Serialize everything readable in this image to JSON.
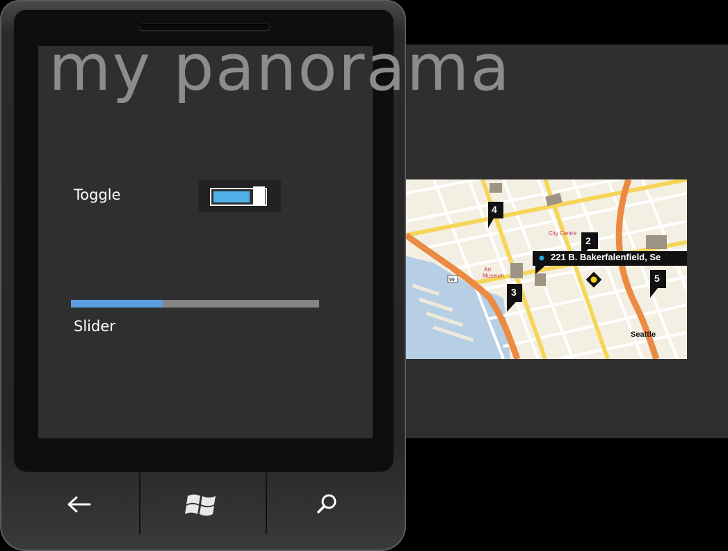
{
  "panorama": {
    "title": "my panorama"
  },
  "toggle": {
    "label": "Toggle",
    "state": "on",
    "accent_color": "#4fb1e7"
  },
  "slider": {
    "label": "Slider",
    "value_fraction": 0.37,
    "fill_color": "#5b9fe0"
  },
  "map": {
    "address_popup": "221 B. Bakerfalenfield, Se",
    "city_label": "Seattle",
    "pins": [
      "4",
      "2",
      "3",
      "5"
    ],
    "poi_labels": [
      "Art Museum",
      "City Centre"
    ],
    "highway_label": "99"
  },
  "hardware_buttons": {
    "back": "back-arrow-icon",
    "start": "windows-logo-icon",
    "search": "search-icon"
  }
}
